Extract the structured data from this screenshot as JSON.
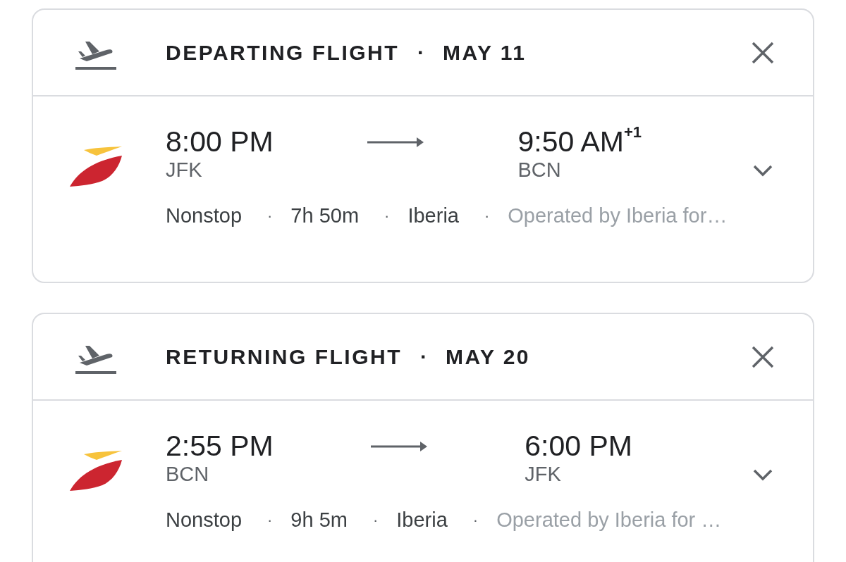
{
  "flights": [
    {
      "title": "DEPARTING FLIGHT",
      "separator": "·",
      "date": "MAY 11",
      "expanded": false,
      "depart_time": "8:00 PM",
      "arrive_time": "9:50 AM",
      "day_offset": "+1",
      "origin": "JFK",
      "destination": "BCN",
      "details": [
        {
          "text": "Nonstop",
          "muted": false
        },
        {
          "text": "7h 50m",
          "muted": false
        },
        {
          "text": "Iberia",
          "muted": false
        },
        {
          "text": "Operated by Iberia for…",
          "muted": true
        }
      ],
      "detail_separator": "·"
    },
    {
      "title": "RETURNING FLIGHT",
      "separator": "·",
      "date": "MAY 20",
      "expanded": false,
      "depart_time": "2:55 PM",
      "arrive_time": "6:00 PM",
      "origin": "BCN",
      "destination": "JFK",
      "details": [
        {
          "text": "Nonstop",
          "muted": false
        },
        {
          "text": "9h 5m",
          "muted": false
        },
        {
          "text": "Iberia",
          "muted": false
        },
        {
          "text": "Operated by Iberia for …",
          "muted": true
        }
      ],
      "detail_separator": "·"
    }
  ]
}
